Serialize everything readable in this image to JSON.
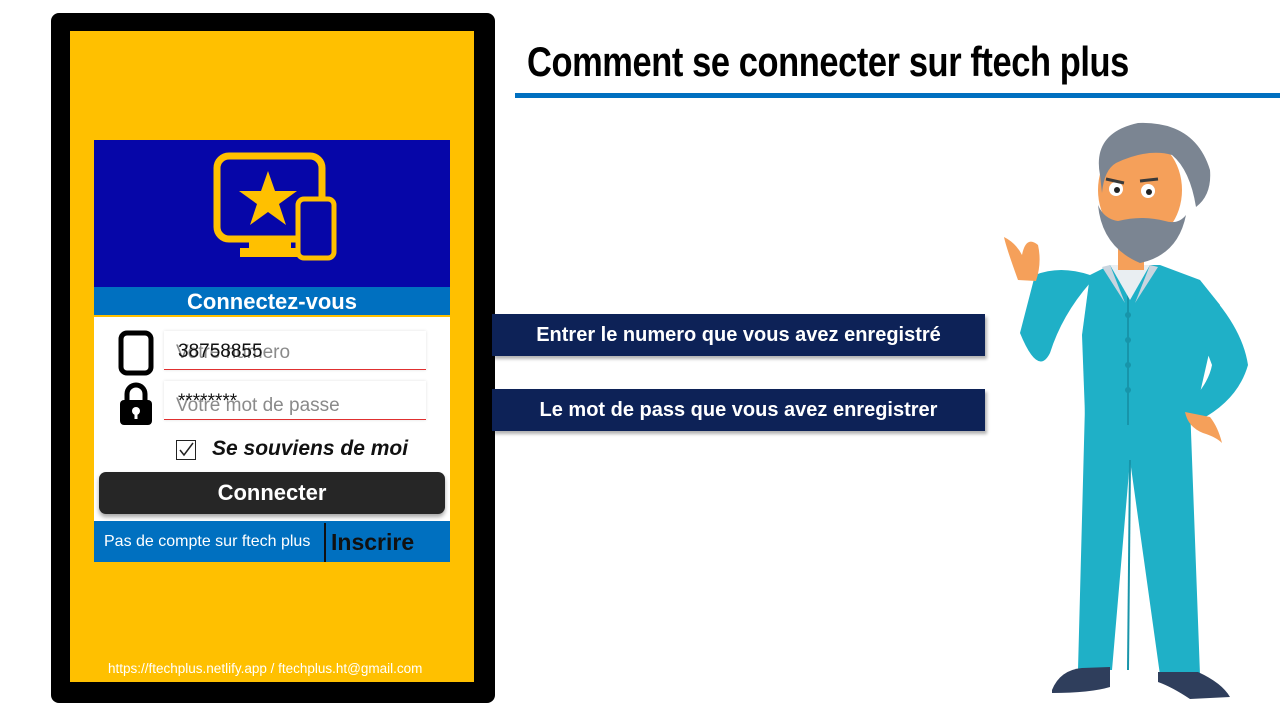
{
  "header": {
    "title": "Comment se connecter sur ftech plus"
  },
  "login_card": {
    "title": "Connectez-vous",
    "phone_field": {
      "value": "38758855",
      "placeholder": "Votre numero"
    },
    "password_field": {
      "value": "********",
      "placeholder": "Votre mot de passe"
    },
    "remember_me": {
      "label": "Se souviens de moi",
      "checked": true
    },
    "connect_button": "Connecter",
    "no_account_text": "Pas de compte sur ftech plus",
    "signup_link": "Inscrire"
  },
  "footer": {
    "contact": "https://ftechplus.netlify.app / ftechplus.ht@gmail.com"
  },
  "callouts": {
    "number": "Entrer le numero que vous avez enregistré",
    "password": "Le mot de pass que vous avez enregistrer"
  },
  "icons": {
    "logo": "monitor-star-icon",
    "phone": "phone-icon",
    "password": "lock-icon",
    "checkbox": "checkmark-icon"
  },
  "colors": {
    "phone_background": "#ffc000",
    "logo_background": "#0606a8",
    "accent_blue": "#0070c0",
    "callout_background": "#0d2257",
    "button_dark": "#262626"
  }
}
